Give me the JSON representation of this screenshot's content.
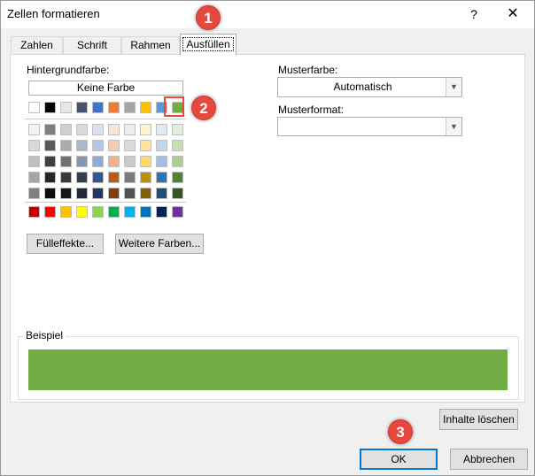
{
  "window": {
    "title": "Zellen formatieren",
    "help_glyph": "?",
    "close_glyph": "✕"
  },
  "tabs": [
    {
      "label": "Zahlen",
      "active": false
    },
    {
      "label": "Schrift",
      "active": false
    },
    {
      "label": "Rahmen",
      "active": false
    },
    {
      "label": "Ausfüllen",
      "active": true
    }
  ],
  "background": {
    "label": "Hintergrundfarbe:",
    "no_color_button": "Keine Farbe",
    "top_row": [
      "#ffffff",
      "#000000",
      "#e7e6e6",
      "#44546a",
      "#4472c4",
      "#ed7d31",
      "#a5a5a5",
      "#ffc000",
      "#5b9bd5",
      "#70ad47"
    ],
    "selected_top_index": 9,
    "tint_rows": [
      [
        "#f2f2f2",
        "#7f7f7f",
        "#d0cece",
        "#d6dce4",
        "#d9e1f2",
        "#fce4d6",
        "#ededed",
        "#fff2cc",
        "#ddebf7",
        "#e2efda"
      ],
      [
        "#d9d9d9",
        "#595959",
        "#aeaaaa",
        "#acb9ca",
        "#b4c6e7",
        "#f8cbad",
        "#dbdbdb",
        "#ffe699",
        "#bdd7ee",
        "#c6e0b4"
      ],
      [
        "#bfbfbf",
        "#404040",
        "#757171",
        "#8497b0",
        "#8ea9db",
        "#f4b084",
        "#c9c9c9",
        "#ffd966",
        "#9bc2e6",
        "#a9d08e"
      ],
      [
        "#a6a6a6",
        "#262626",
        "#3a3838",
        "#333f4f",
        "#305496",
        "#c65911",
        "#7b7b7b",
        "#bf8f00",
        "#2f75b5",
        "#548235"
      ],
      [
        "#808080",
        "#0d0d0d",
        "#161616",
        "#222b35",
        "#203764",
        "#833c0c",
        "#525252",
        "#806000",
        "#1f4e78",
        "#375623"
      ]
    ],
    "standard_row": [
      "#c00000",
      "#ff0000",
      "#ffc000",
      "#ffff00",
      "#92d050",
      "#00b050",
      "#00b0f0",
      "#0070c0",
      "#002060",
      "#7030a0"
    ],
    "fill_effects_button": "Fülleffekte...",
    "more_colors_button": "Weitere Farben..."
  },
  "pattern": {
    "color_label": "Musterfarbe:",
    "color_value": "Automatisch",
    "style_label": "Musterformat:",
    "style_value": ""
  },
  "example": {
    "label": "Beispiel",
    "color": "#70ad47"
  },
  "clear_button": "Inhalte löschen",
  "ok_button": "OK",
  "cancel_button": "Abbrechen",
  "callouts": [
    "1",
    "2",
    "3"
  ],
  "colors": {
    "callout": "#e8473d",
    "accent": "#0078d7"
  }
}
